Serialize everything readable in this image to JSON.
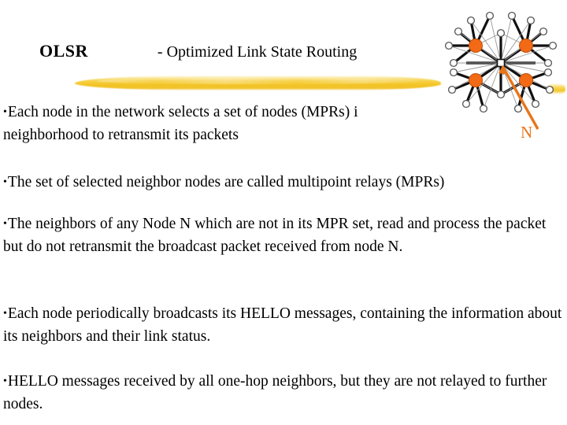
{
  "slide": {
    "title": {
      "main": "OLSR",
      "sub": "- Optimized Link State Routing"
    },
    "bullets": [
      {
        "marker": "•",
        "lines": [
          "Each node in the network selects a set of nodes (MPRs) i",
          "neighborhood to retransmit its packets"
        ]
      },
      {
        "marker": "•",
        "lines": [
          "The set of selected neighbor nodes are called multipoint relays (MPRs)"
        ]
      },
      {
        "marker": "•",
        "lines": [
          "The neighbors of any Node N which are not in its MPR set, read and process the packet but do not retransmit the broadcast packet received from node N."
        ]
      },
      {
        "marker": "•",
        "lines": [
          "Each node periodically broadcasts its HELLO messages, containing the information about its neighbors and their link status."
        ]
      },
      {
        "marker": "•",
        "lines": [
          "HELLO messages received by all one-hop neighbors, but they are not relayed to further nodes."
        ]
      }
    ],
    "graphic": {
      "caption": "N",
      "center_node_label": "N",
      "colors": {
        "mpr_node": "#F26A16",
        "plain_node_stroke": "#555555",
        "plain_node_fill": "#FFFFFF",
        "link": "#111111",
        "arrow": "#E8751A",
        "highlight": "#F3C424"
      }
    }
  }
}
